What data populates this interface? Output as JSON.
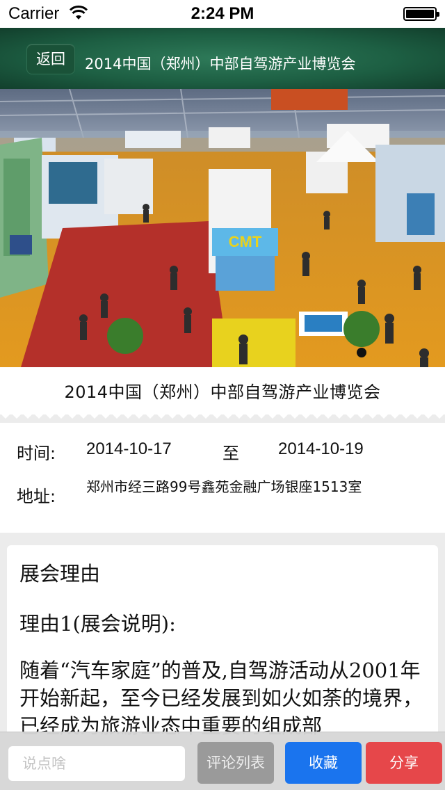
{
  "status_bar": {
    "carrier": "Carrier",
    "time": "2:24 PM"
  },
  "nav": {
    "back_label": "返回",
    "title": "2014中国（郑州）中部自驾游产业博览会"
  },
  "banner": {
    "caption": "2014中国（郑州）中部自驾游产业博览会",
    "booth_sign": "CMT"
  },
  "info": {
    "time_label": "时间:",
    "start_date": "2014-10-17",
    "separator": "至",
    "end_date": "2014-10-19",
    "address_label": "地址:",
    "address": "郑州市经三路99号鑫苑金融广场银座1513室"
  },
  "description": {
    "heading": "展会理由",
    "reason_title": "理由1(展会说明):",
    "body": "随着“汽车家庭”的普及,自驾游活动从2001年开始新起，至今已经发展到如火如荼的境界，已经成为旅游业态中重要的组成部"
  },
  "toolbar": {
    "comment_placeholder": "说点啥",
    "comment_value": "",
    "comments_label": "评论列表",
    "favorite_label": "收藏",
    "share_label": "分享"
  },
  "colors": {
    "nav_green": "#1d5f43",
    "favorite_blue": "#1a74ee",
    "share_red": "#e6474a",
    "comments_gray": "#9a9a9a"
  }
}
